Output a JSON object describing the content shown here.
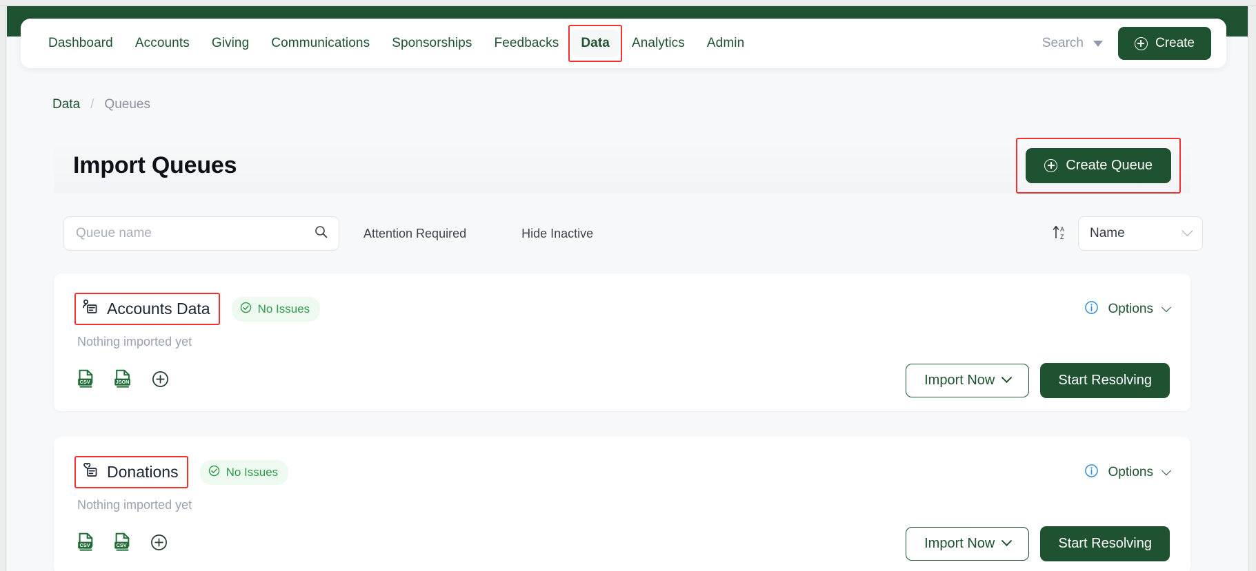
{
  "nav": {
    "links": [
      {
        "label": "Dashboard",
        "active": false,
        "annotated": false
      },
      {
        "label": "Accounts",
        "active": false,
        "annotated": false
      },
      {
        "label": "Giving",
        "active": false,
        "annotated": false
      },
      {
        "label": "Communications",
        "active": false,
        "annotated": false
      },
      {
        "label": "Sponsorships",
        "active": false,
        "annotated": false
      },
      {
        "label": "Feedbacks",
        "active": false,
        "annotated": false
      },
      {
        "label": "Data",
        "active": true,
        "annotated": true
      },
      {
        "label": "Analytics",
        "active": false,
        "annotated": false
      },
      {
        "label": "Admin",
        "active": false,
        "annotated": false
      }
    ],
    "search_label": "Search",
    "create_label": "Create"
  },
  "breadcrumb": {
    "parent": "Data",
    "separator": "/",
    "current": "Queues"
  },
  "page": {
    "title": "Import Queues",
    "create_queue_label": "Create Queue"
  },
  "filters": {
    "search_placeholder": "Queue name",
    "search_value": "",
    "attention_required_label": "Attention Required",
    "hide_inactive_label": "Hide Inactive",
    "sort_value": "Name"
  },
  "queues": [
    {
      "name": "Accounts Data",
      "icon": "account-card-icon",
      "status": "No Issues",
      "empty_text": "Nothing imported yet",
      "sources": [
        "CSV",
        "JSON"
      ],
      "import_label": "Import Now",
      "resolve_label": "Start Resolving",
      "options_label": "Options"
    },
    {
      "name": "Donations",
      "icon": "heart-card-icon",
      "status": "No Issues",
      "empty_text": "Nothing imported yet",
      "sources": [
        "CSV",
        "CSV"
      ],
      "import_label": "Import Now",
      "resolve_label": "Start Resolving",
      "options_label": "Options"
    }
  ],
  "colors": {
    "brand_green": "#1e5230",
    "status_green": "#2f9a4a",
    "status_green_bg": "#eefaf0",
    "annotation_red": "#f0312f",
    "info_blue": "#2f8fe0",
    "page_bg": "#f7f8fa"
  }
}
